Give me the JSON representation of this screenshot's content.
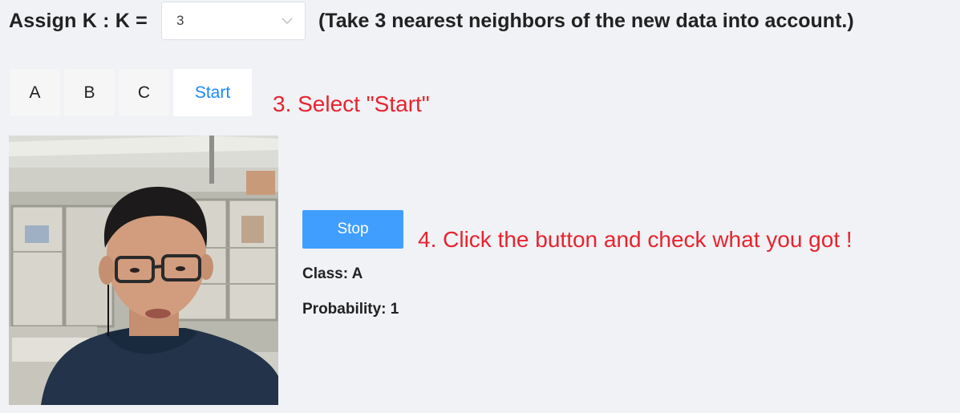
{
  "k_setting": {
    "label": "Assign K : K =",
    "selected_value": "3",
    "hint": "(Take 3 nearest neighbors of the new data into account.)"
  },
  "class_buttons": {
    "a_label": "A",
    "b_label": "B",
    "c_label": "C",
    "start_label": "Start"
  },
  "annotations": {
    "step3": "3. Select \"Start\"",
    "step4": "4. Click the button and check what you got !"
  },
  "controls": {
    "stop_label": "Stop"
  },
  "result": {
    "class_text": "Class: A",
    "probability_text": "Probability: 1"
  },
  "colors": {
    "accent": "#409eff",
    "start_text": "#1989fa",
    "annotation": "#e8232e",
    "background": "#f0f2f5"
  },
  "icons": {
    "select_arrow": "chevron-down-icon"
  }
}
